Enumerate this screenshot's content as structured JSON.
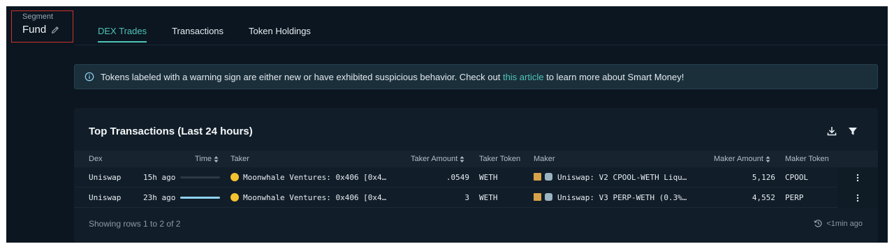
{
  "segment": {
    "label": "Segment",
    "value": "Fund"
  },
  "tabs": [
    {
      "label": "DEX Trades"
    },
    {
      "label": "Transactions"
    },
    {
      "label": "Token Holdings"
    }
  ],
  "banner": {
    "text_before": "Tokens labeled with a warning sign are either new or have exhibited suspicious behavior. Check out ",
    "link": "this article",
    "text_after": " to learn more about Smart Money!"
  },
  "card": {
    "title": "Top Transactions (Last 24 hours)",
    "columns": {
      "dex": "Dex",
      "time": "Time",
      "taker": "Taker",
      "taker_amount": "Taker Amount",
      "taker_token": "Taker Token",
      "maker": "Maker",
      "maker_amount": "Maker Amount",
      "maker_token": "Maker Token"
    },
    "rows": [
      {
        "dex": "Uniswap",
        "time": "15h ago",
        "time_level": 0.0,
        "taker": "Moonwhale Ventures: 0x406 [0x4…",
        "taker_amount": ".0549",
        "taker_token": "WETH",
        "maker": "Uniswap: V2 CPOOL-WETH Liqu…",
        "maker_amount": "5,126",
        "maker_token": "CPOOL"
      },
      {
        "dex": "Uniswap",
        "time": "23h ago",
        "time_level": 1.0,
        "taker": "Moonwhale Ventures: 0x406 [0x4…",
        "taker_amount": "3",
        "taker_token": "WETH",
        "maker": "Uniswap: V3 PERP-WETH (0.3%…",
        "maker_amount": "4,552",
        "maker_token": "PERP"
      }
    ],
    "footer": "Showing rows 1 to 2 of 2",
    "updated": "<1min ago"
  },
  "colors": {
    "accent": "#4fc3b8",
    "background": "#0b1620",
    "highlight": "#d0312d"
  }
}
